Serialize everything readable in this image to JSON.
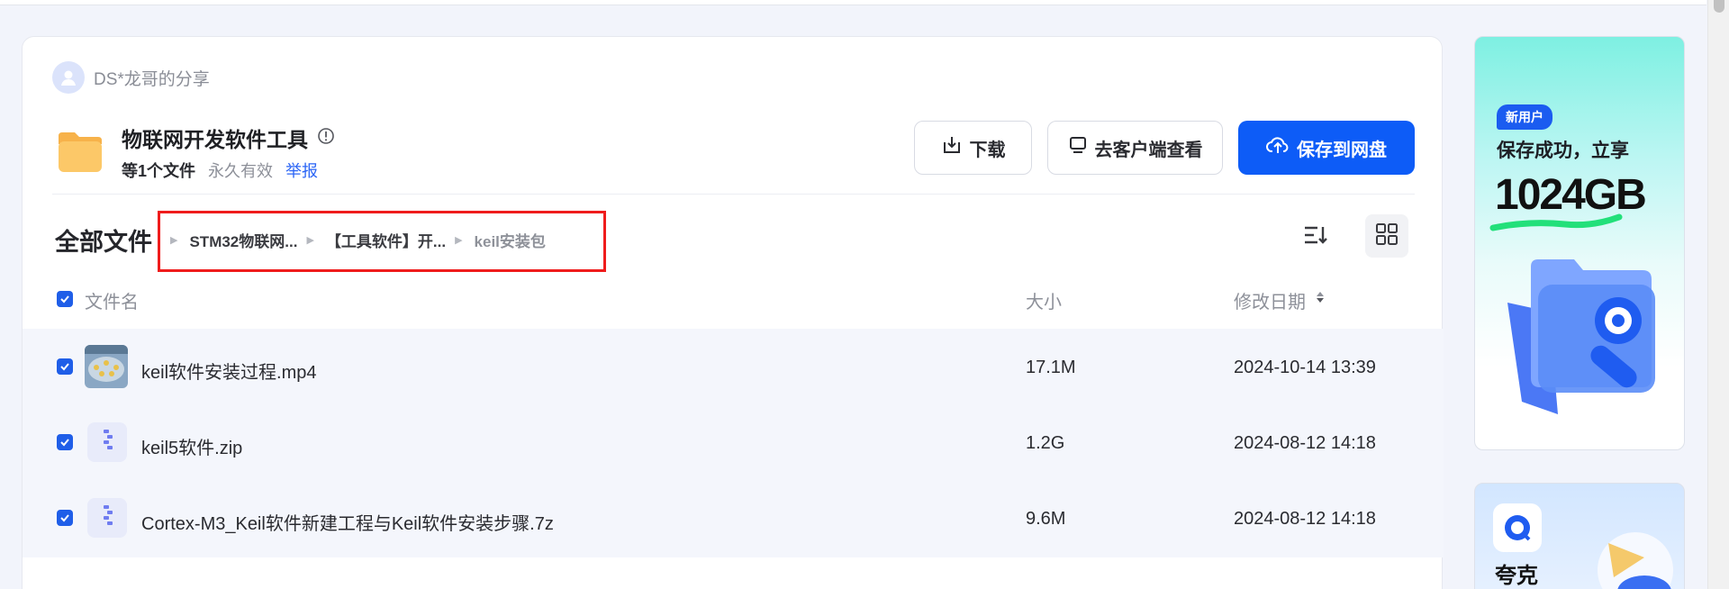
{
  "share": {
    "sharer_name": "DS*龙哥的分享",
    "folder_title": "物联网开发软件工具",
    "file_count": "等1个文件",
    "validity": "永久有效",
    "report": "举报"
  },
  "actions": {
    "download": "下载",
    "open_client": "去客户端查看",
    "save": "保存到网盘"
  },
  "breadcrumb": {
    "root": "全部文件",
    "items": [
      "STM32物联网...",
      "【工具软件】开...",
      "keil安装包"
    ]
  },
  "list": {
    "columns": {
      "name": "文件名",
      "size": "大小",
      "date": "修改日期"
    },
    "rows": [
      {
        "name": "keil软件安装过程.mp4",
        "size": "17.1M",
        "date": "2024-10-14 13:39",
        "icon": "video-thumbnail"
      },
      {
        "name": "keil5软件.zip",
        "size": "1.2G",
        "date": "2024-08-12 14:18",
        "icon": "zip-file-icon"
      },
      {
        "name": "Cortex-M3_Keil软件新建工程与Keil软件安装步骤.7z",
        "size": "9.6M",
        "date": "2024-08-12 14:18",
        "icon": "zip-file-icon"
      }
    ]
  },
  "ads": {
    "badge": "新用户",
    "line": "保存成功，立享",
    "big": "1024GB",
    "brand": "夸克"
  },
  "colors": {
    "accent": "#0d5cf7",
    "highlight": "#ef1c1c",
    "checkbox": "#1f5ee8"
  }
}
